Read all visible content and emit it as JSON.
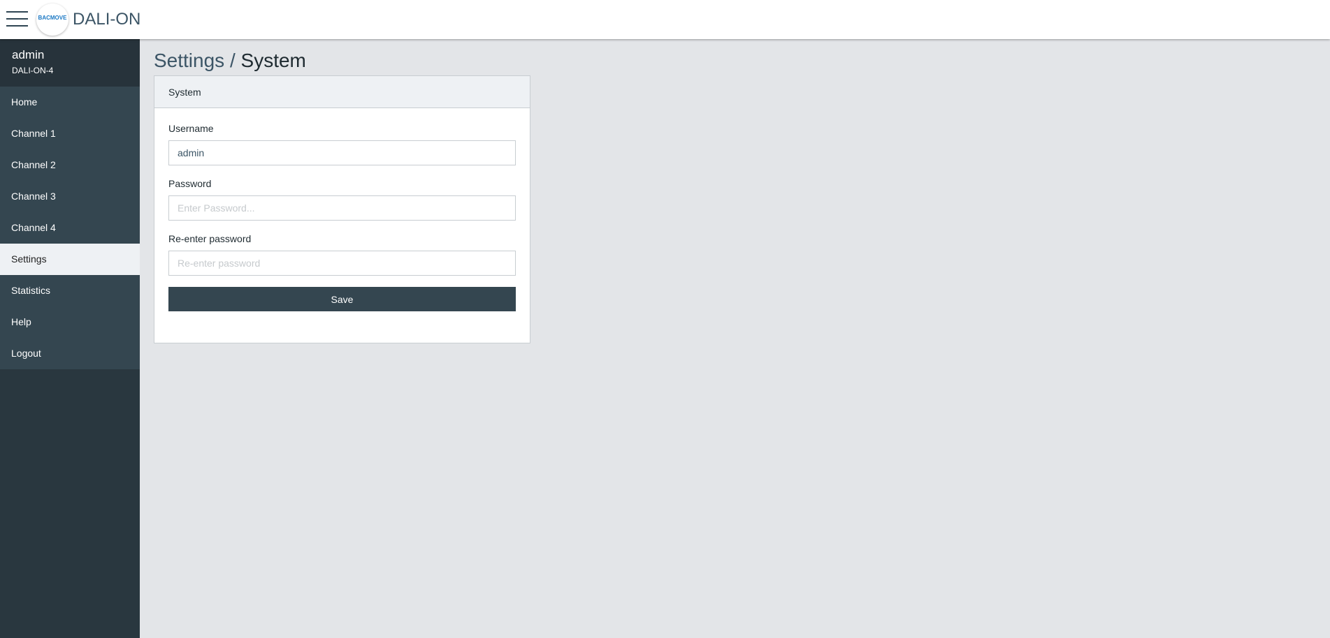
{
  "header": {
    "app_title": "DALI-ON",
    "logo_text": "BACMOVE"
  },
  "sidebar": {
    "user": {
      "name": "admin",
      "device": "DALI-ON-4"
    },
    "items": [
      {
        "label": "Home"
      },
      {
        "label": "Channel 1"
      },
      {
        "label": "Channel 2"
      },
      {
        "label": "Channel 3"
      },
      {
        "label": "Channel 4"
      },
      {
        "label": "Settings"
      },
      {
        "label": "Statistics"
      },
      {
        "label": "Help"
      },
      {
        "label": "Logout"
      }
    ],
    "active_item": "Settings"
  },
  "main": {
    "breadcrumb": {
      "section": "Settings",
      "separator": " / ",
      "page": "System"
    },
    "card": {
      "title": "System",
      "username": {
        "label": "Username",
        "value": "admin"
      },
      "password": {
        "label": "Password",
        "placeholder": "Enter Password..."
      },
      "reenter": {
        "label": "Re-enter password",
        "placeholder": "Re-enter password"
      },
      "save_label": "Save"
    }
  },
  "colors": {
    "sidebar_bg": "#29373f",
    "nav_bg": "#344650",
    "active_bg": "#eef1f4",
    "button_bg": "#344650",
    "content_bg": "#e3e5e8",
    "logo_blue": "#1b78c4"
  }
}
